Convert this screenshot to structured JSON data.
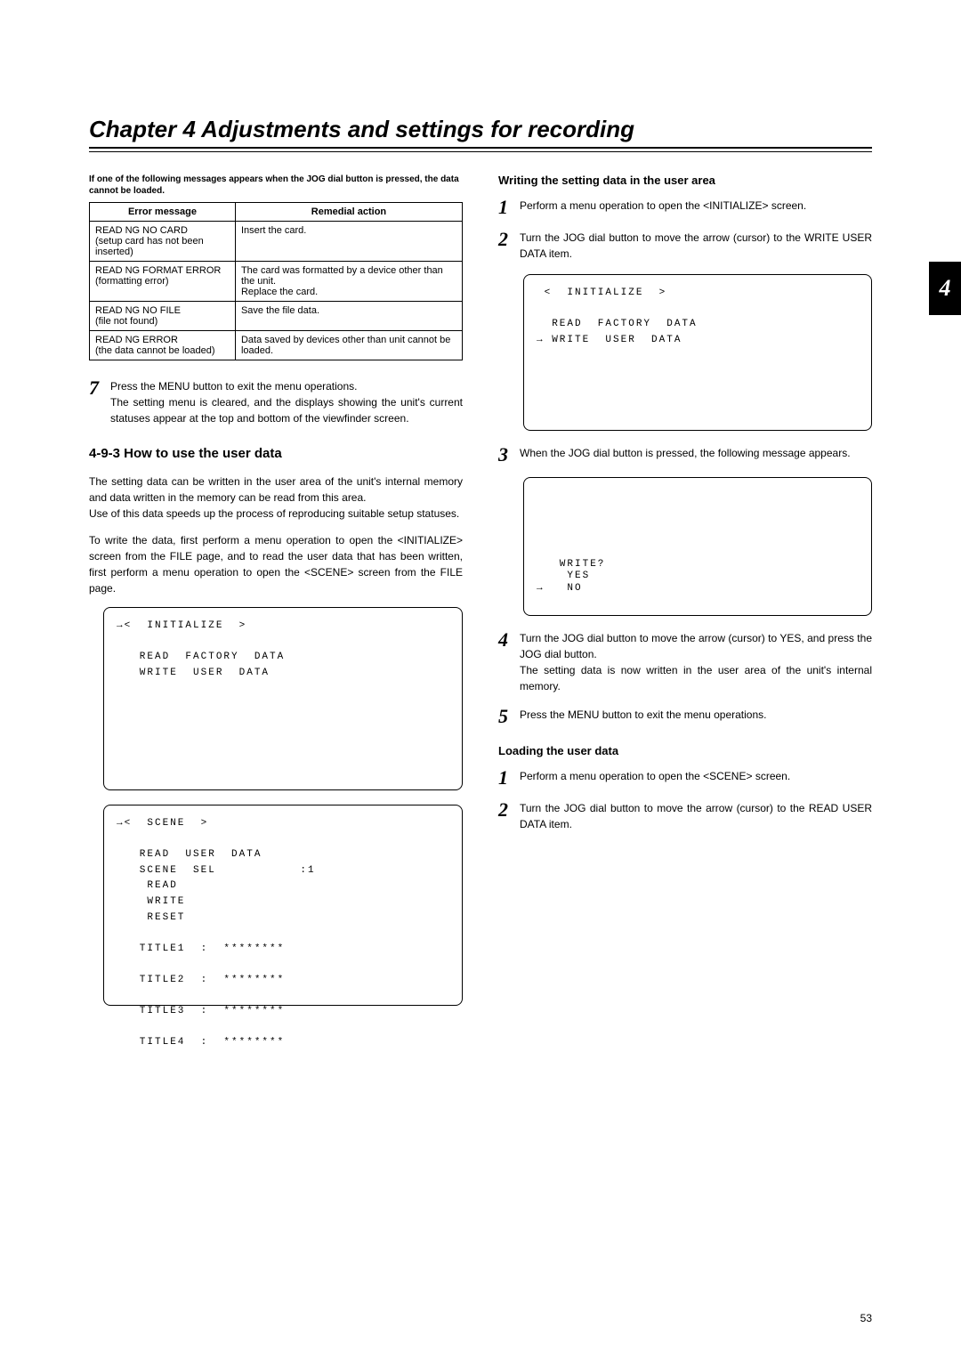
{
  "chapter_title": "Chapter 4  Adjustments and settings for recording",
  "side_tab": "4",
  "page_number": "53",
  "left": {
    "note": "If one of the following messages appears when the JOG dial button is pressed, the data cannot be loaded.",
    "table": {
      "headers": [
        "Error message",
        "Remedial action"
      ],
      "rows": [
        [
          "READ NG NO CARD\n(setup card has not been inserted)",
          "Insert the card."
        ],
        [
          "READ NG FORMAT ERROR\n(formatting error)",
          "The card was formatted by a device other than the unit.\nReplace the card."
        ],
        [
          "READ NG NO FILE\n(file not found)",
          "Save the file data."
        ],
        [
          "READ NG ERROR\n(the data cannot be loaded)",
          "Data saved by devices other than unit cannot be loaded."
        ]
      ]
    },
    "step7": {
      "num": "7",
      "text": "Press the MENU button to exit the menu operations.\nThe setting menu is cleared, and the displays showing the unit's current statuses appear at the top and bottom of the viewfinder screen."
    },
    "section": "4-9-3 How to use the user data",
    "para1": "The setting data can be written in the user area of the unit's internal memory and data written in the memory can be read from this area.\nUse of this data speeds up the process of reproducing suitable setup statuses.",
    "para2": "To write the data, first perform a menu operation to open the <INITIALIZE> screen from the FILE page, and to read the user data that has been written, first perform a menu operation to open the <SCENE> screen from the FILE page.",
    "screen1": "→<  INITIALIZE  >\n\n   READ  FACTORY  DATA\n   WRITE  USER  DATA",
    "screen2": "→<  SCENE  >\n\n   READ  USER  DATA\n   SCENE  SEL           :1\n    READ\n    WRITE\n    RESET\n\n   TITLE1  :  ********\n\n   TITLE2  :  ********\n\n   TITLE3  :  ********\n\n   TITLE4  :  ********"
  },
  "right": {
    "sub_heading1": "Writing the setting data in the user area",
    "step1": {
      "num": "1",
      "text": "Perform a menu operation to open the <INITIALIZE> screen."
    },
    "step2": {
      "num": "2",
      "text": "Turn the JOG dial button to move the arrow (cursor) to the WRITE USER DATA item."
    },
    "screen1": " <  INITIALIZE  >\n\n  READ  FACTORY  DATA\n→ WRITE  USER  DATA",
    "step3": {
      "num": "3",
      "text": "When the JOG dial button is pressed, the following message appears."
    },
    "screen2": "\n\n\n\n\n\n   WRITE?\n    YES\n→   NO ",
    "step4": {
      "num": "4",
      "text": "Turn the JOG dial button to move the arrow (cursor) to YES, and press the JOG dial button.\nThe setting data is now written in the user area of the unit's internal memory."
    },
    "step5": {
      "num": "5",
      "text": "Press the MENU button to exit the menu operations."
    },
    "sub_heading2": "Loading the user data",
    "load_step1": {
      "num": "1",
      "text": "Perform a menu operation to open the <SCENE> screen."
    },
    "load_step2": {
      "num": "2",
      "text": "Turn the JOG dial button to move the arrow (cursor) to the READ USER DATA item."
    }
  }
}
